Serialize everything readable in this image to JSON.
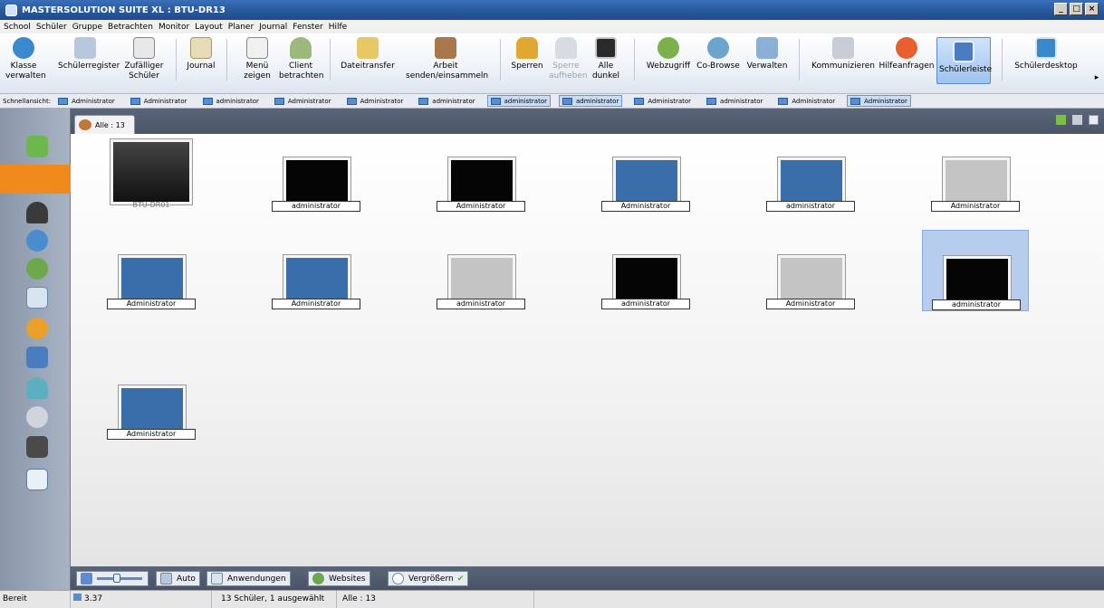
{
  "window": {
    "title": "MASTERSOLUTION SUITE XL : BTU-DR13",
    "controls": [
      "_",
      "□",
      "×"
    ]
  },
  "menu": [
    "School",
    "Schüler",
    "Gruppe",
    "Betrachten",
    "Monitor",
    "Layout",
    "Planer",
    "Journal",
    "Fenster",
    "Hilfe"
  ],
  "ribbon": {
    "buttons": [
      {
        "label": "Klasse\nverwalten",
        "icon": "class-manage-icon"
      },
      {
        "label": "Schülerregister",
        "icon": "student-register-icon"
      },
      {
        "label": "Zufälliger\nSchüler",
        "icon": "dice-icon"
      },
      {
        "label": "Journal",
        "icon": "journal-icon"
      },
      {
        "label": "Menü\nzeigen",
        "icon": "menu-show-icon"
      },
      {
        "label": "Client\nbetrachten",
        "icon": "client-view-icon"
      },
      {
        "label": "Dateitransfer",
        "icon": "folder-transfer-icon"
      },
      {
        "label": "Arbeit\nsenden/einsammeln",
        "icon": "briefcase-icon"
      },
      {
        "label": "Sperren",
        "icon": "lock-icon"
      },
      {
        "label": "Sperre\naufheben",
        "icon": "unlock-icon"
      },
      {
        "label": "Alle\ndunkel",
        "icon": "monitor-dark-icon"
      },
      {
        "label": "Webzugriff",
        "icon": "web-access-icon"
      },
      {
        "label": "Co-Browse",
        "icon": "co-browse-icon"
      },
      {
        "label": "Verwalten",
        "icon": "manage-icon"
      },
      {
        "label": "Kommunizieren",
        "icon": "communicate-icon"
      },
      {
        "label": "Hilfeanfragen",
        "icon": "lifebuoy-icon"
      },
      {
        "label": "Schülerleiste",
        "icon": "student-bar-icon"
      },
      {
        "label": "Schülerdesktop",
        "icon": "student-desktop-icon"
      }
    ],
    "more_arrow": "▸"
  },
  "quickview": {
    "label": "Schnellansicht:",
    "items": [
      "Administrator",
      "Administrator",
      "administrator",
      "Administrator",
      "Administrator",
      "administrator",
      "administrator",
      "administrator",
      "Administrator",
      "administrator",
      "Administrator",
      "Administrator"
    ]
  },
  "tab": {
    "label": "Alle : 13"
  },
  "computers": [
    {
      "label": "BTU-DR01",
      "screen": "dark"
    },
    {
      "label": "administrator",
      "screen": "black"
    },
    {
      "label": "Administrator",
      "screen": "black"
    },
    {
      "label": "Administrator",
      "screen": "blue"
    },
    {
      "label": "administrator",
      "screen": "blue"
    },
    {
      "label": "Administrator",
      "screen": "grey"
    },
    {
      "label": "Administrator",
      "screen": "blue"
    },
    {
      "label": "Administrator",
      "screen": "blue"
    },
    {
      "label": "administrator",
      "screen": "grey"
    },
    {
      "label": "administrator",
      "screen": "black"
    },
    {
      "label": "Administrator",
      "screen": "grey"
    },
    {
      "label": "administrator",
      "screen": "black"
    },
    {
      "label": "Administrator",
      "screen": "blue"
    }
  ],
  "bottom_toolbar": {
    "auto": "Auto",
    "apps": "Anwendungen",
    "websites": "Websites",
    "zoom": "Vergrößern"
  },
  "status": {
    "state": "Bereit",
    "version": "3.37",
    "summary": "13 Schüler, 1 ausgewählt",
    "group": "Alle : 13"
  }
}
